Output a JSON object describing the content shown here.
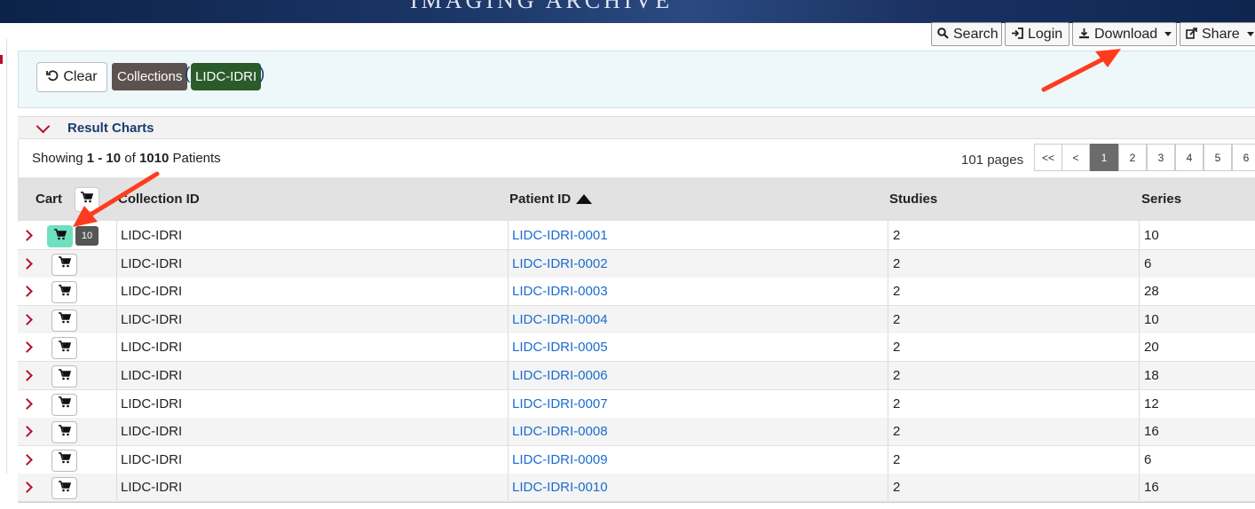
{
  "header": {
    "banner_text": "IMAGING ARCHIVE",
    "buttons": {
      "search": "Search",
      "login": "Login",
      "download": "Download",
      "share": "Share"
    }
  },
  "filters": {
    "clear_label": "Clear",
    "category_pill": "Collections",
    "open_paren": "(",
    "close_paren": ")",
    "value_pill": "LIDC-IDRI"
  },
  "result_charts": {
    "title": "Result Charts"
  },
  "summary": {
    "prefix": "Showing",
    "range": "1 - 10",
    "of": "of",
    "total": "1010",
    "unit": "Patients"
  },
  "pagination": {
    "pages_label": "101 pages",
    "first": "<<",
    "prev": "<",
    "pages": [
      "1",
      "2",
      "3",
      "4",
      "5",
      "6"
    ],
    "active_page": "1"
  },
  "table": {
    "columns": {
      "cart": "Cart",
      "collection": "Collection ID",
      "patient": "Patient ID",
      "studies": "Studies",
      "series": "Series"
    },
    "rows": [
      {
        "collection": "LIDC-IDRI",
        "patient": "LIDC-IDRI-0001",
        "studies": "2",
        "series": "10",
        "in_cart": true,
        "cart_count": "10"
      },
      {
        "collection": "LIDC-IDRI",
        "patient": "LIDC-IDRI-0002",
        "studies": "2",
        "series": "6",
        "in_cart": false
      },
      {
        "collection": "LIDC-IDRI",
        "patient": "LIDC-IDRI-0003",
        "studies": "2",
        "series": "28",
        "in_cart": false
      },
      {
        "collection": "LIDC-IDRI",
        "patient": "LIDC-IDRI-0004",
        "studies": "2",
        "series": "10",
        "in_cart": false
      },
      {
        "collection": "LIDC-IDRI",
        "patient": "LIDC-IDRI-0005",
        "studies": "2",
        "series": "20",
        "in_cart": false
      },
      {
        "collection": "LIDC-IDRI",
        "patient": "LIDC-IDRI-0006",
        "studies": "2",
        "series": "18",
        "in_cart": false
      },
      {
        "collection": "LIDC-IDRI",
        "patient": "LIDC-IDRI-0007",
        "studies": "2",
        "series": "12",
        "in_cart": false
      },
      {
        "collection": "LIDC-IDRI",
        "patient": "LIDC-IDRI-0008",
        "studies": "2",
        "series": "16",
        "in_cart": false
      },
      {
        "collection": "LIDC-IDRI",
        "patient": "LIDC-IDRI-0009",
        "studies": "2",
        "series": "6",
        "in_cart": false
      },
      {
        "collection": "LIDC-IDRI",
        "patient": "LIDC-IDRI-0010",
        "studies": "2",
        "series": "16",
        "in_cart": false
      }
    ]
  },
  "colors": {
    "accent_red": "#b30f2f",
    "link_blue": "#1a6ccf",
    "cart_added": "#6ee0c0",
    "annotation_arrow": "#ff3b1f"
  }
}
